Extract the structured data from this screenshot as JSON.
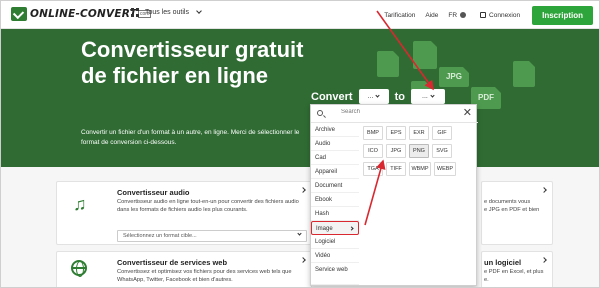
{
  "nav": {
    "logo_text": "ONLINE-CONVERT",
    "logo_suffix": "com",
    "all_tools": "Tous les outils",
    "pricing": "Tarification",
    "help": "Aide",
    "lang": "FR",
    "login": "Connexion",
    "signup": "Inscription"
  },
  "hero": {
    "title": "Convertisseur gratuit de fichier en ligne",
    "description": "Convertir un fichier d'un format à un autre, en ligne. Merci de sélectionner le format de conversion ci-dessous.",
    "convert_label": "Convert",
    "to_label": "to",
    "from_value": "...",
    "to_value": "...",
    "doc_icons": [
      "",
      "",
      "JPG",
      "",
      "PDF",
      ""
    ]
  },
  "dropdown": {
    "search_placeholder": "Search",
    "categories": [
      "Archive",
      "Audio",
      "Cad",
      "Appareil",
      "Document",
      "Ebook",
      "Hash",
      "Image",
      "Logiciel",
      "Vidéo",
      "Service web"
    ],
    "active_category": "Image",
    "formats": [
      "BMP",
      "EPS",
      "EXR",
      "GIF",
      "ICO",
      "JPG",
      "PNG",
      "SVG",
      "TGA",
      "TIFF",
      "WBMP",
      "WEBP"
    ],
    "selected_format": "PNG"
  },
  "cards": {
    "audio": {
      "title": "Convertisseur audio",
      "description": "Convertisseur audio en ligne tout-en-un pour convertir des fichiers audio dans les formats de fichiers audio les plus courants.",
      "select_placeholder": "Sélectionnez un format cible..."
    },
    "web": {
      "title": "Convertisseur de services web",
      "description": "Convertissez et optimisez vos fichiers pour des services web tels que WhatsApp, Twitter, Facebook et bien d'autres."
    },
    "right_top": {
      "text_line1": "e documents vous",
      "text_line2": "e JPG en PDF et bien"
    },
    "right_bottom": {
      "title": "un logiciel",
      "text_line1": "e PDF en Excel, et plus",
      "text_line2": "e."
    }
  },
  "colors": {
    "brand_green": "#2f6b33",
    "signup_green": "#2ea53a",
    "annotation_red": "#d9282f"
  }
}
